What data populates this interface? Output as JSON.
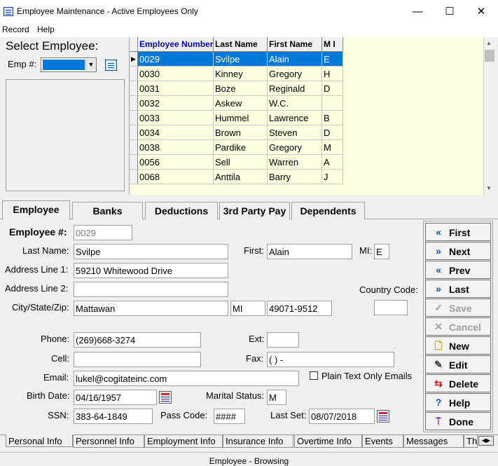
{
  "window": {
    "title": "Employee Maintenance - Active Employees Only",
    "minimize": "—",
    "maximize": "☐",
    "close": "✕"
  },
  "menu": {
    "record": "Record",
    "help": "Help"
  },
  "select": {
    "heading": "Select Employee:",
    "emp_label": "Emp #:"
  },
  "grid": {
    "columns": [
      "Employee Number",
      "Last Name",
      "First Name",
      "M I"
    ],
    "rows": [
      [
        "0029",
        "Svilpe",
        "Alain",
        "E"
      ],
      [
        "0030",
        "Kinney",
        "Gregory",
        "H"
      ],
      [
        "0031",
        "Boze",
        "Reginald",
        "D"
      ],
      [
        "0032",
        "Askew",
        "W.C.",
        ""
      ],
      [
        "0033",
        "Hummel",
        "Lawrence",
        "B"
      ],
      [
        "0034",
        "Brown",
        "Steven",
        "D"
      ],
      [
        "0038",
        "Pardike",
        "Gregory",
        "M"
      ],
      [
        "0056",
        "Sell",
        "Warren",
        "A"
      ],
      [
        "0068",
        "Anttila",
        "Barry",
        "J"
      ]
    ],
    "selected_row": 0
  },
  "tabs_top": [
    "Employee",
    "Banks",
    "Deductions",
    "3rd Party Pay",
    "Dependents"
  ],
  "form": {
    "employee_label": "Employee #:",
    "employee_value": "0029",
    "last_name_label": "Last Name:",
    "last_name_value": "Svilpe",
    "first_label": "First:",
    "first_value": "Alain",
    "mi_label": "MI:",
    "mi_value": "E",
    "addr1_label": "Address Line 1:",
    "addr1_value": "59210 Whitewood Drive",
    "addr2_label": "Address Line 2:",
    "addr2_value": "",
    "country_label": "Country Code:",
    "country_value": "",
    "csz_label": "City/State/Zip:",
    "city_value": "Mattawan",
    "state_value": "MI",
    "zip_value": "49071-9512",
    "phone_label": "Phone:",
    "phone_value": "(269)668-3274",
    "ext_label": "Ext:",
    "ext_value": "",
    "cell_label": "Cell:",
    "cell_value": "",
    "fax_label": "Fax:",
    "fax_value": "(  )    -",
    "email_label": "Email:",
    "email_value": "lukel@cogitateinc.com",
    "plain_text_label": "Plain Text Only Emails",
    "birth_label": "Birth Date:",
    "birth_value": "04/16/1957",
    "marital_label": "Marital Status:",
    "marital_value": "M",
    "ssn_label": "SSN:",
    "ssn_value": "383-64-1849",
    "pass_label": "Pass Code:",
    "pass_value": "####",
    "lastset_label": "Last Set:",
    "lastset_value": "08/07/2018"
  },
  "buttons": [
    {
      "label": "First",
      "icon": "first-icon",
      "enabled": true
    },
    {
      "label": "Next",
      "icon": "next-icon",
      "enabled": true
    },
    {
      "label": "Prev",
      "icon": "prev-icon",
      "enabled": true
    },
    {
      "label": "Last",
      "icon": "last-icon",
      "enabled": true
    },
    {
      "label": "Save",
      "icon": "check-icon",
      "enabled": false
    },
    {
      "label": "Cancel",
      "icon": "cancel-icon",
      "enabled": false
    },
    {
      "label": "New",
      "icon": "new-document-icon",
      "enabled": true
    },
    {
      "label": "Edit",
      "icon": "edit-icon",
      "enabled": true
    },
    {
      "label": "Delete",
      "icon": "delete-icon",
      "enabled": true
    },
    {
      "label": "Help",
      "icon": "help-icon",
      "enabled": true
    },
    {
      "label": "Done",
      "icon": "done-icon",
      "enabled": true
    }
  ],
  "tabs_bottom": [
    "Personal Info",
    "Personnel Info",
    "Employment Info",
    "Insurance Info",
    "Overtime Info",
    "Events",
    "Messages",
    "Th"
  ],
  "status": "Employee - Browsing",
  "colors": {
    "selection": "#0078d7",
    "grid_bg": "#ffffe1",
    "header_link": "#0000c0"
  }
}
